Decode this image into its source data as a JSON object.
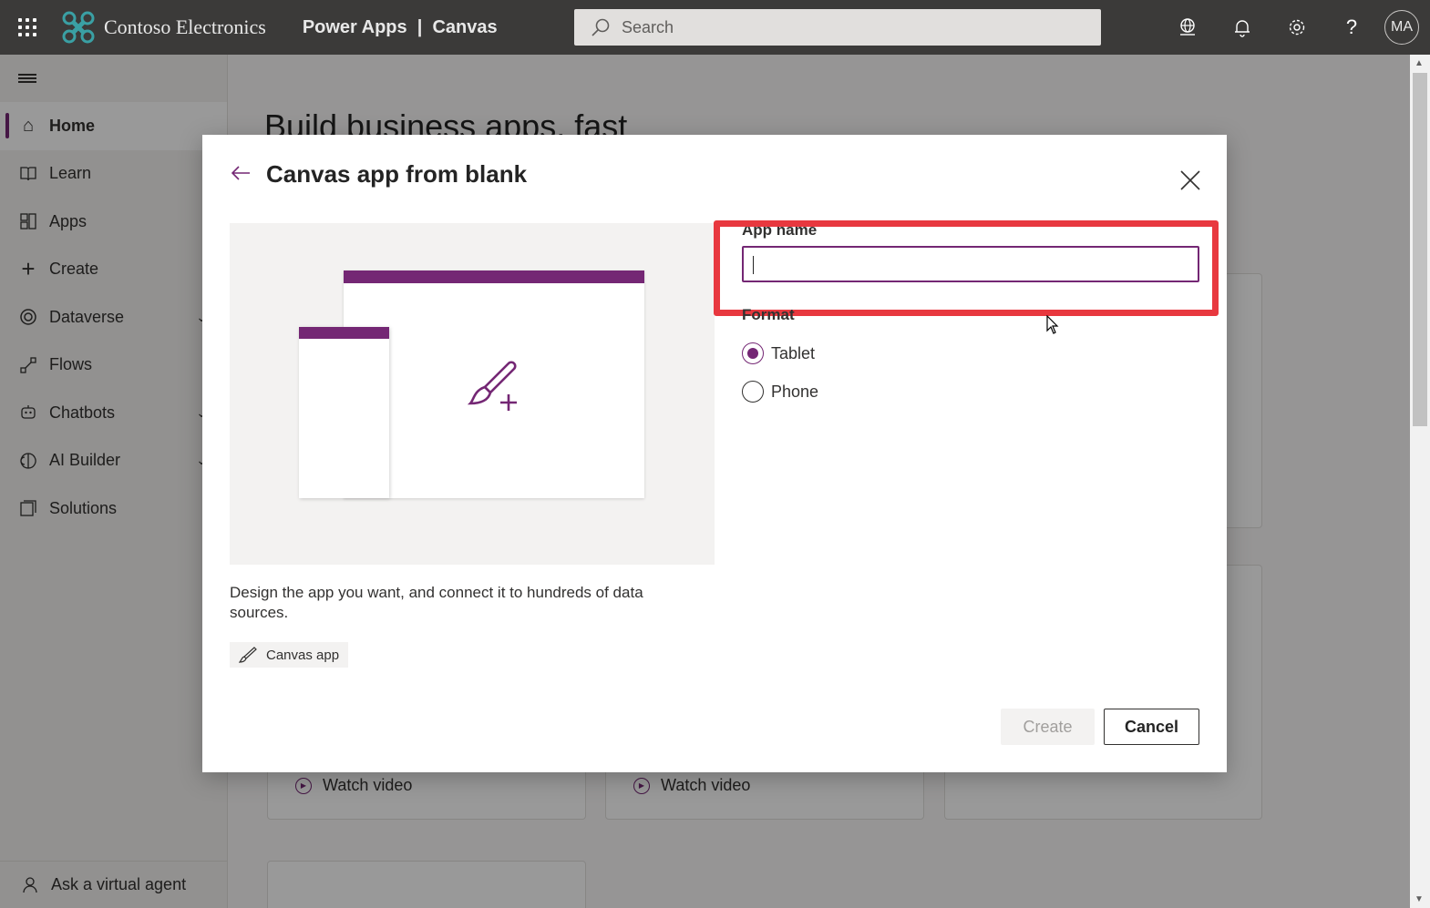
{
  "topbar": {
    "brand": "Contoso Electronics",
    "product": "Power Apps  |  Canvas",
    "search_placeholder": "Search",
    "avatar": "MA"
  },
  "sidebar": {
    "items": [
      {
        "label": "Home"
      },
      {
        "label": "Learn"
      },
      {
        "label": "Apps"
      },
      {
        "label": "Create"
      },
      {
        "label": "Dataverse"
      },
      {
        "label": "Flows"
      },
      {
        "label": "Chatbots"
      },
      {
        "label": "AI Builder"
      },
      {
        "label": "Solutions"
      }
    ],
    "ask_agent": "Ask a virtual agent"
  },
  "main": {
    "title": "Build business apps, fast",
    "watch_video_1": "Watch video",
    "watch_video_2": "Watch video"
  },
  "dialog": {
    "title": "Canvas app from blank",
    "description": "Design the app you want, and connect it to hundreds of data sources.",
    "tag": "Canvas app",
    "app_name_label": "App name",
    "app_name_value": "",
    "format_label": "Format",
    "format_options": [
      {
        "label": "Tablet",
        "selected": true
      },
      {
        "label": "Phone",
        "selected": false
      }
    ],
    "create_label": "Create",
    "cancel_label": "Cancel"
  },
  "colors": {
    "accent": "#742774",
    "topbar": "#3b3a39",
    "highlight": "#e8383f"
  }
}
